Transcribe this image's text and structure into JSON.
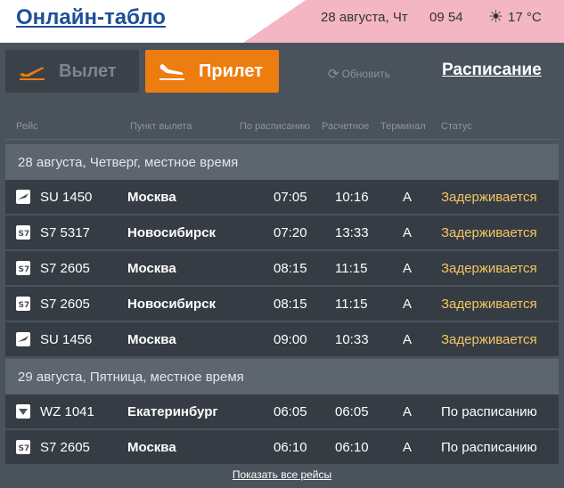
{
  "header": {
    "title": "Онлайн-табло",
    "date": "28 августа, Чт",
    "time": "09 54",
    "temperature": "17 °C",
    "weather_icon": "sun-icon"
  },
  "tabs": {
    "departures_label": "Вылет",
    "arrivals_label": "Прилет",
    "active": "arrivals"
  },
  "toolbar": {
    "refresh_label": "Обновить",
    "schedule_label": "Расписание"
  },
  "columns": {
    "flight": "Рейс",
    "from": "Пункт вылета",
    "scheduled": "По расписанию",
    "estimated": "Расчетное",
    "terminal": "Терминал",
    "status": "Статус"
  },
  "groups": [
    {
      "date_label": "28 августа, Четверг, местное время",
      "flights": [
        {
          "flight": "SU 1450",
          "city": "Москва",
          "scheduled": "07:05",
          "estimated": "10:16",
          "terminal": "A",
          "status": "Задерживается",
          "airline_icon": "aeroflot-logo-icon"
        },
        {
          "flight": "S7 5317",
          "city": "Новосибирск",
          "scheduled": "07:20",
          "estimated": "13:33",
          "terminal": "A",
          "status": "Задерживается",
          "airline_icon": "s7-logo-icon"
        },
        {
          "flight": "S7 2605",
          "city": "Москва",
          "scheduled": "08:15",
          "estimated": "11:15",
          "terminal": "A",
          "status": "Задерживается",
          "airline_icon": "s7-logo-icon"
        },
        {
          "flight": "S7 2605",
          "city": "Новосибирск",
          "scheduled": "08:15",
          "estimated": "11:15",
          "terminal": "A",
          "status": "Задерживается",
          "airline_icon": "s7-logo-icon"
        },
        {
          "flight": "SU 1456",
          "city": "Москва",
          "scheduled": "09:00",
          "estimated": "10:33",
          "terminal": "A",
          "status": "Задерживается",
          "airline_icon": "aeroflot-logo-icon"
        }
      ]
    },
    {
      "date_label": "29 августа, Пятница, местное время",
      "flights": [
        {
          "flight": "WZ 1041",
          "city": "Екатеринбург",
          "scheduled": "06:05",
          "estimated": "06:05",
          "terminal": "A",
          "status": "По расписанию",
          "airline_icon": "redwings-logo-icon"
        },
        {
          "flight": "S7 2605",
          "city": "Москва",
          "scheduled": "06:10",
          "estimated": "06:10",
          "terminal": "A",
          "status": "По расписанию",
          "airline_icon": "s7-logo-icon"
        }
      ]
    }
  ],
  "footer": {
    "show_all_label": "Показать все рейсы"
  },
  "colors": {
    "accent": "#ee7d10",
    "delay_status": "#f2c764",
    "title": "#1e4f9a"
  }
}
